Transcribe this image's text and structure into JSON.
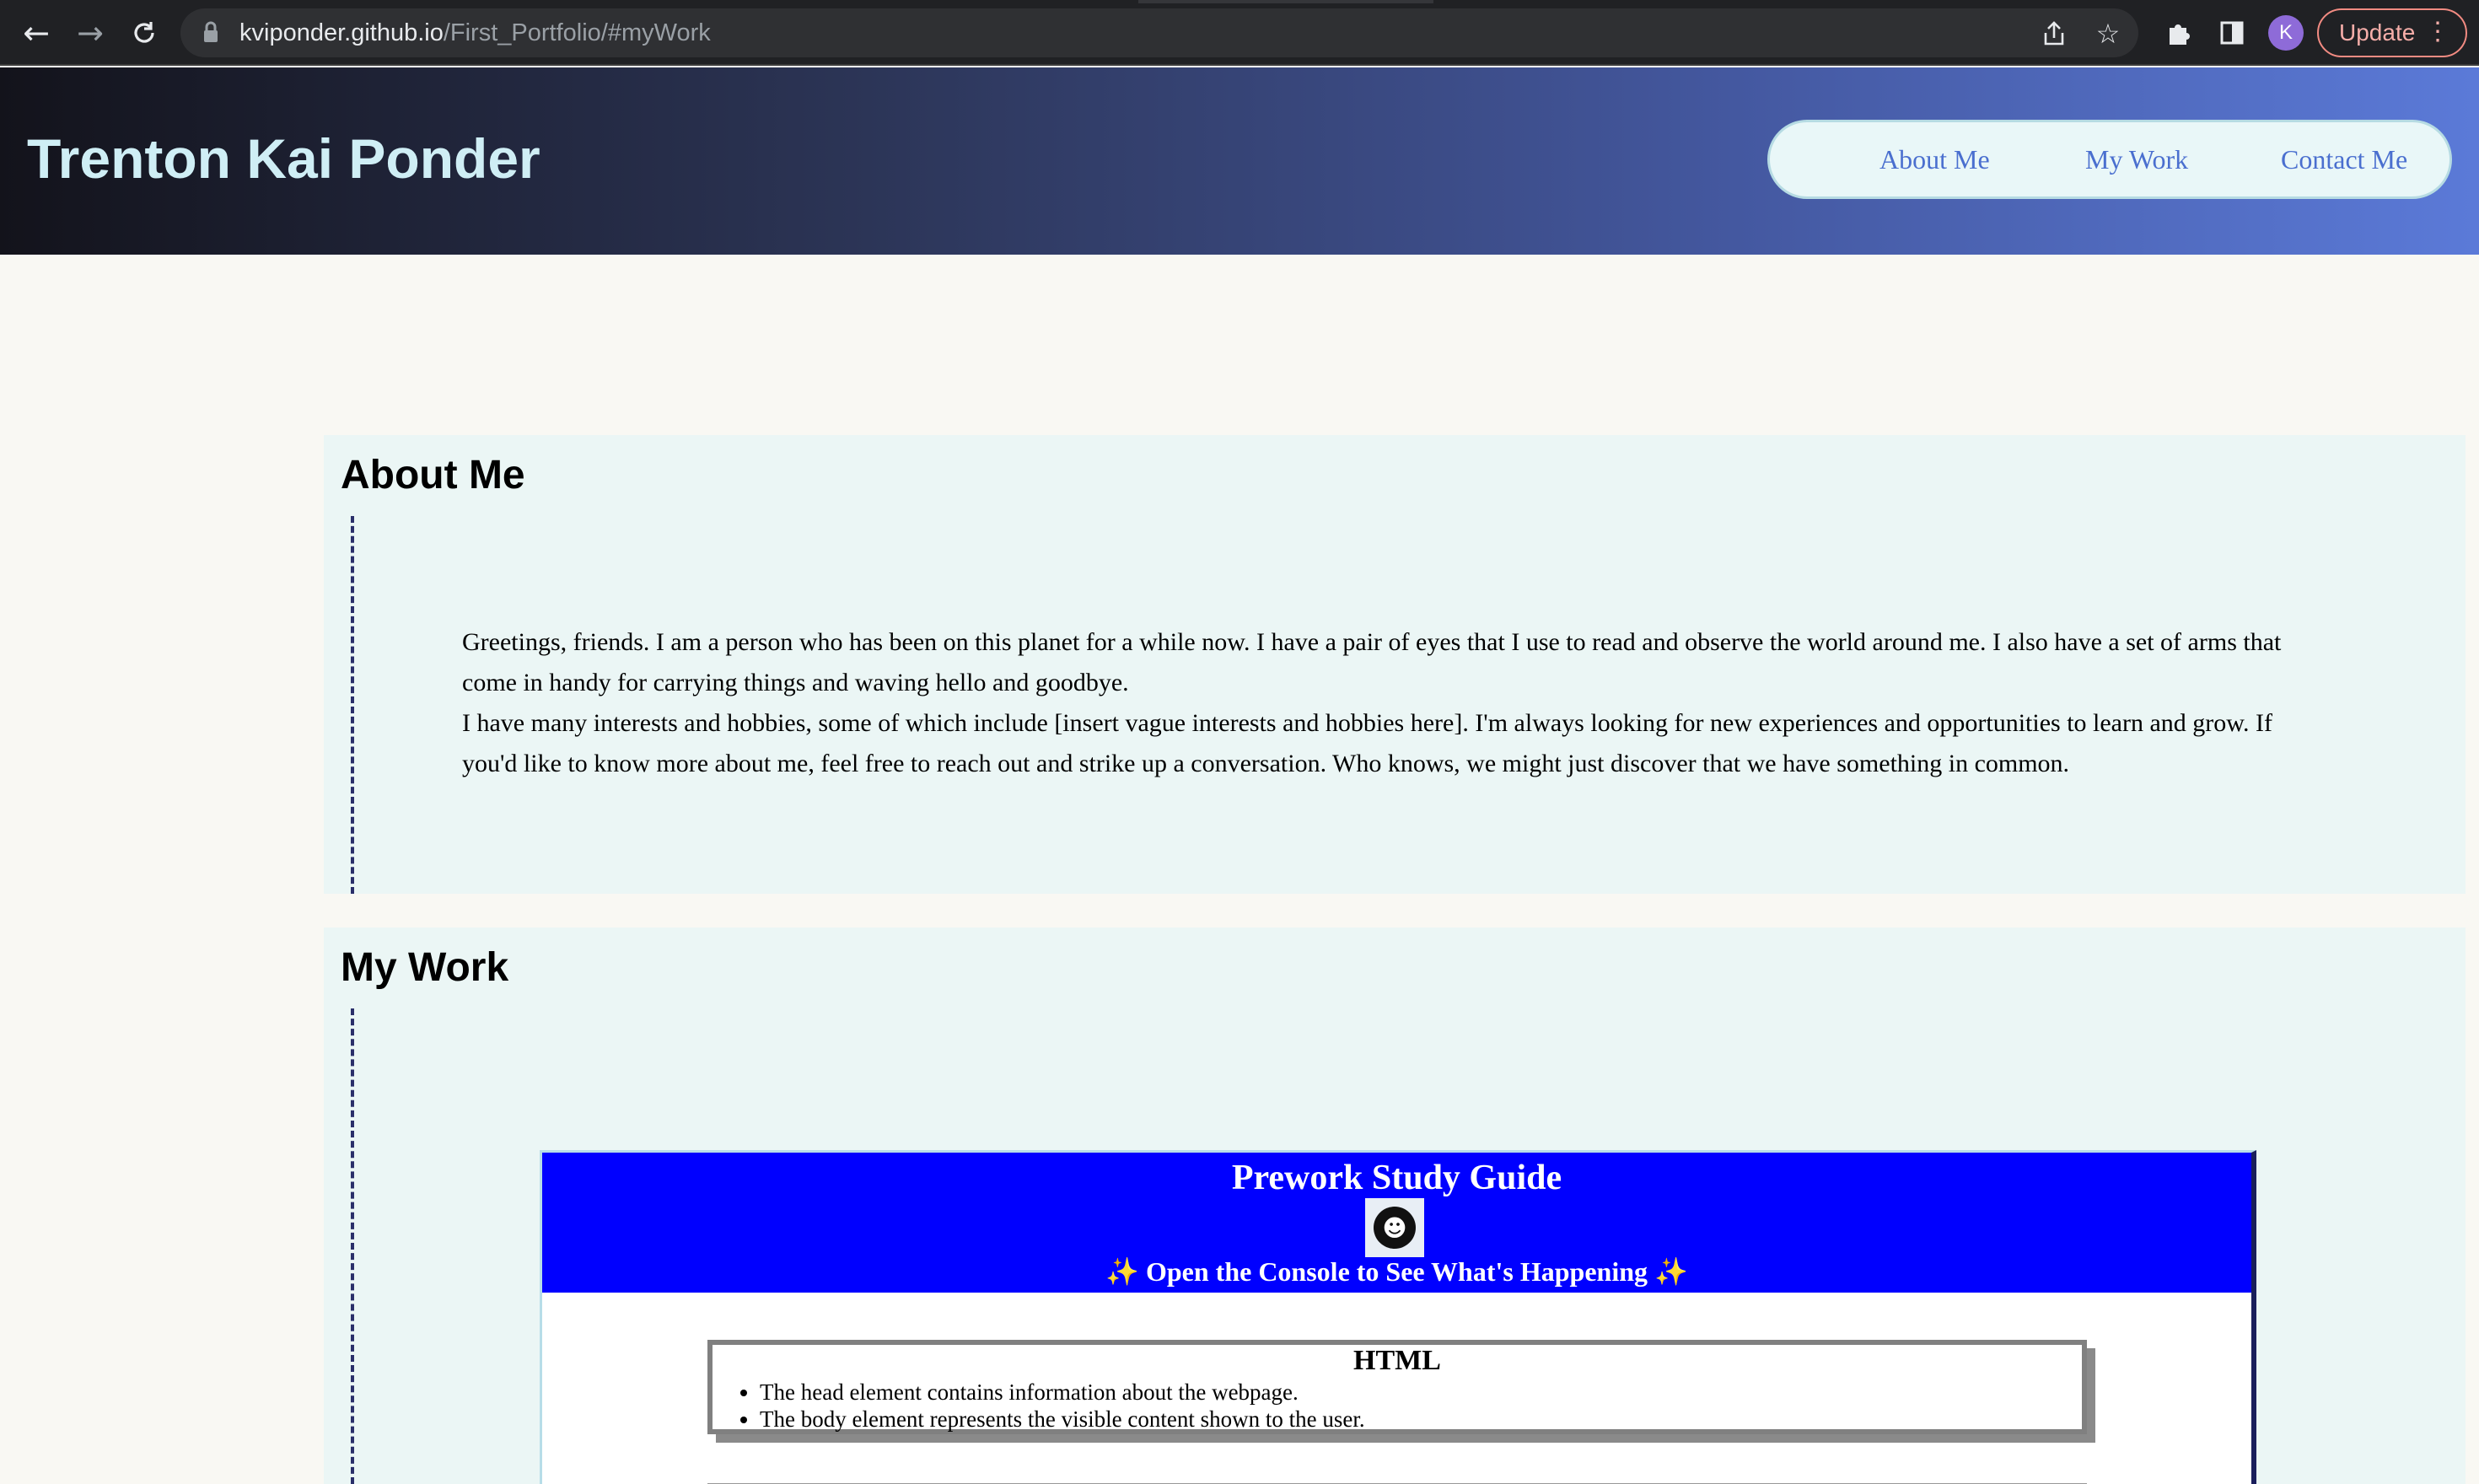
{
  "browser": {
    "url_host": "kviponder.github.io",
    "url_path": "/First_Portfolio/#myWork",
    "avatar_letter": "K",
    "update_label": "Update"
  },
  "header": {
    "title": "Trenton Kai Ponder",
    "nav": [
      "About Me",
      "My Work",
      "Contact Me"
    ]
  },
  "about": {
    "heading": "About Me",
    "paragraphs": [
      "Greetings, friends. I am a person who has been on this planet for a while now. I have a pair of eyes that I use to read and observe the world around me. I also have a set of arms that come in handy for carrying things and waving hello and goodbye.",
      "I have many interests and hobbies, some of which include [insert vague interests and hobbies here]. I'm always looking for new experiences and opportunities to learn and grow. If you'd like to know more about me, feel free to reach out and strike up a conversation. Who knows, we might just discover that we have something in common."
    ]
  },
  "work": {
    "heading": "My Work",
    "preview": {
      "title": "Prework Study Guide",
      "subtitle": "✨ Open the Console to See What's Happening ✨",
      "card_title": "HTML",
      "card_items": [
        "The head element contains information about the webpage.",
        "The body element represents the visible content shown to the user."
      ]
    }
  }
}
